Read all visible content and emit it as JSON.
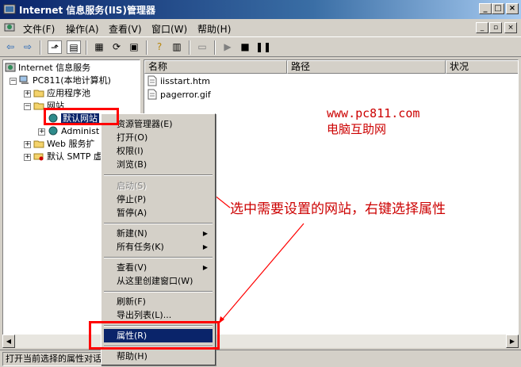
{
  "window": {
    "title": "Internet 信息服务(IIS)管理器",
    "minimize": "_",
    "maximize": "□",
    "close": "×"
  },
  "menubar": {
    "items": [
      "文件(F)",
      "操作(A)",
      "查看(V)",
      "窗口(W)",
      "帮助(H)"
    ],
    "mdi_buttons": [
      "_",
      "▫",
      "×"
    ]
  },
  "tree": {
    "root": "Internet 信息服务",
    "computer": "PC811(本地计算机)",
    "app_pools": "应用程序池",
    "websites": "网站",
    "default_site": "默认网站",
    "admin_site": "Administ",
    "web_ext": "Web 服务扩",
    "smtp": "默认 SMTP 虚"
  },
  "list": {
    "columns": [
      "名称",
      "路径",
      "状况"
    ],
    "files": [
      "iisstart.htm",
      "pagerror.gif"
    ]
  },
  "context_menu": {
    "resource_manager": "资源管理器(E)",
    "open": "打开(O)",
    "permissions": "权限(I)",
    "browse": "浏览(B)",
    "start": "启动(S)",
    "stop": "停止(P)",
    "pause": "暂停(A)",
    "new": "新建(N)",
    "all_tasks": "所有任务(K)",
    "view": "查看(V)",
    "new_window": "从这里创建窗口(W)",
    "refresh": "刷新(F)",
    "export": "导出列表(L)...",
    "properties": "属性(R)",
    "help": "帮助(H)"
  },
  "annotation": {
    "watermark_url": "www.pc811.com",
    "watermark_name": "电脑互助网",
    "instruction": "选中需要设置的网站，右键选择属性"
  },
  "status": {
    "text": "打开当前选择的属性对话框。"
  },
  "colors": {
    "title_start": "#0a246a",
    "title_end": "#a6caf0",
    "highlight": "#0a246a",
    "annotation_red": "#ff0000"
  }
}
